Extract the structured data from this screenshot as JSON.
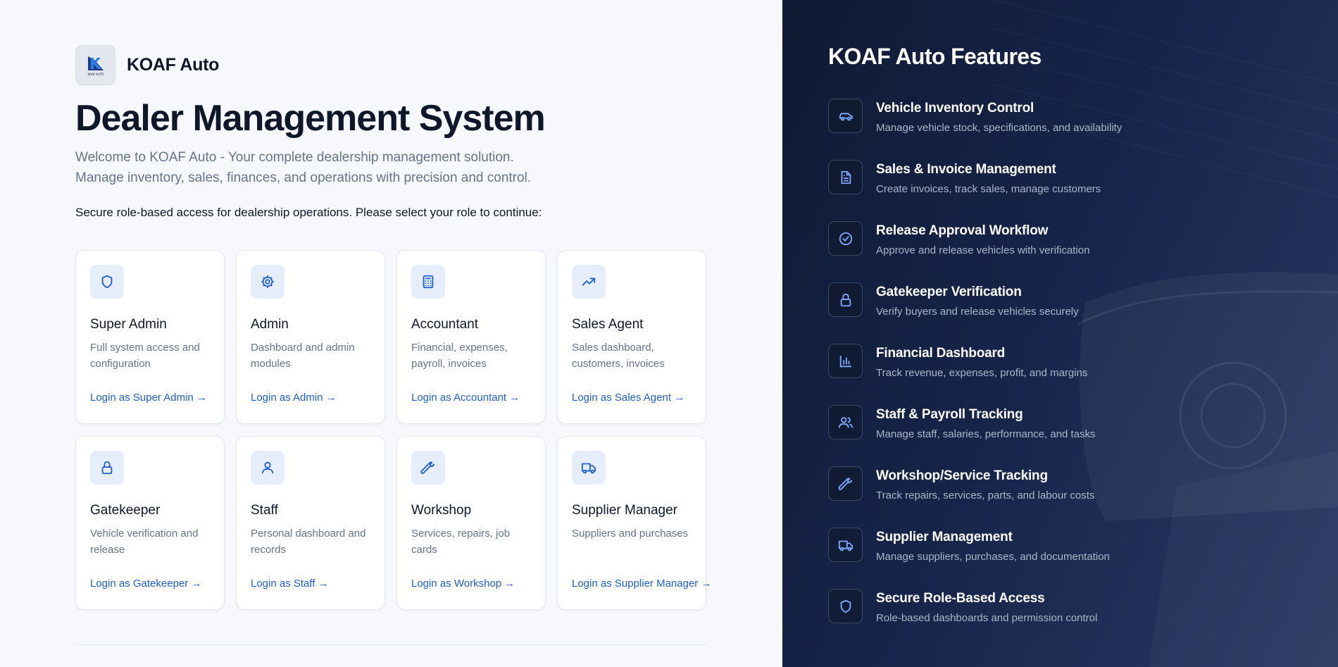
{
  "brand": {
    "name": "KOAF Auto",
    "logo_text": "KOAF AUTO"
  },
  "hero": {
    "title": "Dealer Management System",
    "intro_line1": "Welcome to KOAF Auto - Your complete dealership management solution.",
    "intro_line2": "Manage inventory, sales, finances, and operations with precision and control.",
    "prompt": "Secure role-based access for dealership operations. Please select your role to continue:"
  },
  "roles": [
    {
      "icon": "shield-icon",
      "title": "Super Admin",
      "desc": "Full system access and configuration",
      "link": "Login as Super Admin →"
    },
    {
      "icon": "gear-icon",
      "title": "Admin",
      "desc": "Dashboard and admin modules",
      "link": "Login as Admin →"
    },
    {
      "icon": "calculator-icon",
      "title": "Accountant",
      "desc": "Financial, expenses, payroll, invoices",
      "link": "Login as Accountant →"
    },
    {
      "icon": "trending-up-icon",
      "title": "Sales Agent",
      "desc": "Sales dashboard, customers, invoices",
      "link": "Login as Sales Agent →"
    },
    {
      "icon": "lock-icon",
      "title": "Gatekeeper",
      "desc": "Vehicle verification and release",
      "link": "Login as Gatekeeper →"
    },
    {
      "icon": "user-icon",
      "title": "Staff",
      "desc": "Personal dashboard and records",
      "link": "Login as Staff →"
    },
    {
      "icon": "wrench-icon",
      "title": "Workshop",
      "desc": "Services, repairs, job cards",
      "link": "Login as Workshop →"
    },
    {
      "icon": "truck-icon",
      "title": "Supplier Manager",
      "desc": "Suppliers and purchases",
      "link": "Login as Supplier Manager →"
    }
  ],
  "features_panel": {
    "title": "KOAF Auto Features",
    "items": [
      {
        "icon": "car-icon",
        "name": "Vehicle Inventory Control",
        "desc": "Manage vehicle stock, specifications, and availability"
      },
      {
        "icon": "document-icon",
        "name": "Sales & Invoice Management",
        "desc": "Create invoices, track sales, manage customers"
      },
      {
        "icon": "check-circle-icon",
        "name": "Release Approval Workflow",
        "desc": "Approve and release vehicles with verification"
      },
      {
        "icon": "lock-icon",
        "name": "Gatekeeper Verification",
        "desc": "Verify buyers and release vehicles securely"
      },
      {
        "icon": "bar-chart-icon",
        "name": "Financial Dashboard",
        "desc": "Track revenue, expenses, profit, and margins"
      },
      {
        "icon": "users-icon",
        "name": "Staff & Payroll Tracking",
        "desc": "Manage staff, salaries, performance, and tasks"
      },
      {
        "icon": "wrench-icon",
        "name": "Workshop/Service Tracking",
        "desc": "Track repairs, services, parts, and labour costs"
      },
      {
        "icon": "truck-icon",
        "name": "Supplier Management",
        "desc": "Manage suppliers, purchases, and documentation"
      },
      {
        "icon": "shield-icon",
        "name": "Secure Role-Based Access",
        "desc": "Role-based dashboards and permission control"
      }
    ]
  },
  "colors": {
    "accent": "#1d5fd6",
    "panel": "#16244a",
    "heading": "#0f172a",
    "muted": "#64748b"
  }
}
